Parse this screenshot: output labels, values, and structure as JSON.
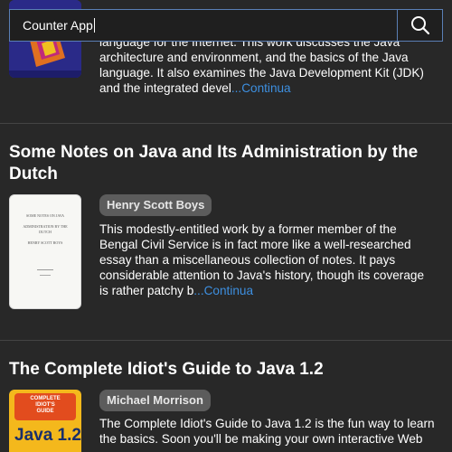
{
  "search": {
    "value": "Counter App"
  },
  "books": [
    {
      "desc_lines": [
        "language for the Internet. This work discusses the Java",
        "architecture and environment, and the basics of the Java",
        "language. It also examines the Java Development Kit (JDK)",
        "and the integrated devel"
      ],
      "more": "...Continua"
    },
    {
      "title_lines": [
        "Some Notes on Java and Its Administration by the",
        "Dutch"
      ],
      "author": "Henry Scott Boys",
      "desc_lines": [
        "This modestly-entitled work by a former member of the",
        "Bengal Civil Service is in fact more like a well-researched",
        "essay than a miscellaneous collection of notes. It pays",
        "considerable attention to Java's history, though its coverage",
        "is rather patchy b"
      ],
      "more": "...Continua",
      "cover_text": [
        "SOME NOTES ON JAVA",
        "ADMINISTRATION BY THE DUTCH",
        "HENRY SCOTT BOYS"
      ]
    },
    {
      "title_lines": [
        "The Complete Idiot's Guide to Java 1.2"
      ],
      "author": "Michael Morrison",
      "desc_lines": [
        "The Complete Idiot's Guide to Java 1.2 is the fun way to learn",
        "the basics. Soon you'll be making your own interactive Web"
      ],
      "cover_text": [
        "COMPLETE",
        "IDIOT'S",
        "GUIDE",
        "Java 1.2"
      ]
    }
  ],
  "colors": {
    "background": "#282828",
    "link": "#3d8fe0",
    "chip": "#5c5c5c",
    "search_border": "#5a7fb5"
  }
}
